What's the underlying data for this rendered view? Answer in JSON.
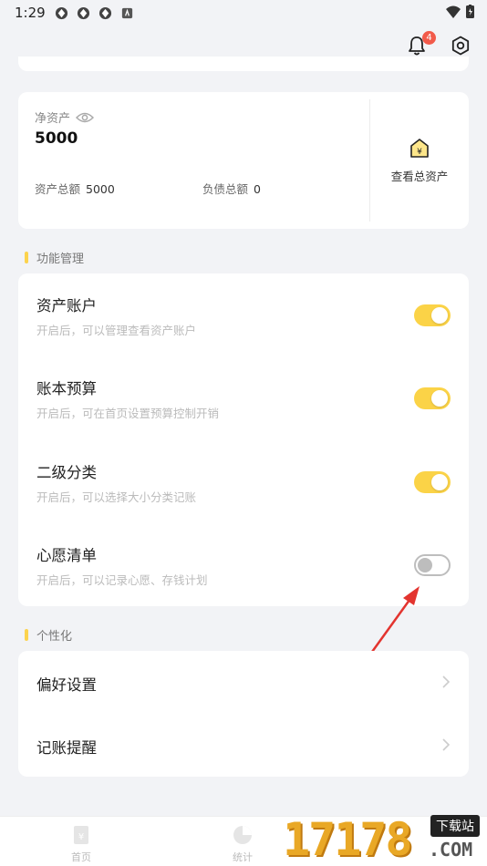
{
  "status": {
    "time": "1:29"
  },
  "header": {
    "notification_count": "4"
  },
  "asset_card": {
    "net_label": "净资产",
    "net_value": "5000",
    "total_assets_label": "资产总额",
    "total_assets_value": "5000",
    "total_debt_label": "负债总额",
    "total_debt_value": "0",
    "view_all_label": "查看总资产"
  },
  "sections": {
    "features_title": "功能管理",
    "personal_title": "个性化"
  },
  "features": [
    {
      "title": "资产账户",
      "desc": "开启后，可以管理查看资产账户",
      "enabled": true
    },
    {
      "title": "账本预算",
      "desc": "开启后，可在首页设置预算控制开销",
      "enabled": true
    },
    {
      "title": "二级分类",
      "desc": "开启后，可以选择大小分类记账",
      "enabled": true
    },
    {
      "title": "心愿清单",
      "desc": "开启后，可以记录心愿、存钱计划",
      "enabled": false
    }
  ],
  "personal": [
    {
      "title": "偏好设置"
    },
    {
      "title": "记账提醒"
    }
  ],
  "tabs": [
    {
      "label": "首页"
    },
    {
      "label": "统计"
    }
  ],
  "watermark": {
    "text": "17178",
    "site": "下载站",
    "domain": ".COM"
  },
  "colors": {
    "accent": "#fbd347",
    "badge": "#f25a4a",
    "background": "#f2f3f6"
  }
}
